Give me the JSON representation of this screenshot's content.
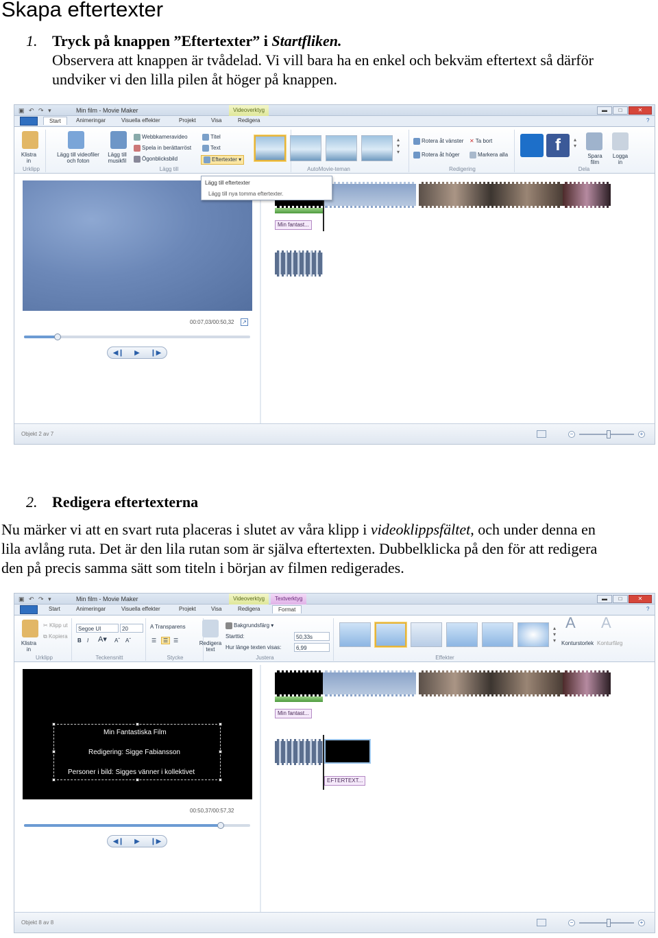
{
  "doc": {
    "title": "Skapa eftertexter",
    "step1": {
      "num": "1.",
      "heading_a": "Tryck på knappen ”Eftertexter” i ",
      "heading_b": "Startfliken.",
      "line2": "Observera att knappen är tvådelad. Vi vill bara ha en enkel och bekväm eftertext så därför",
      "line3": "undviker vi den lilla pilen åt höger på knappen."
    },
    "step2": {
      "num": "2.",
      "heading": "Redigera eftertexterna",
      "p1a": "Nu märker vi att en svart ruta placeras i slutet av våra klipp i ",
      "p1b": "videoklippsfältet",
      "p1c": ", och under denna en",
      "p2": "lila avlång ruta. Det är den lila rutan som är själva eftertexten. Dubbelklicka på den för att redigera",
      "p3": "den på precis samma sätt som titeln i början av filmen redigerades."
    }
  },
  "shot1": {
    "window_title": "Min film - Movie Maker",
    "context_tab": "Videoverktyg",
    "tabs": [
      "Start",
      "Animeringar",
      "Visuella effekter",
      "Projekt",
      "Visa",
      "Redigera"
    ],
    "ribbon": {
      "klistra": "Klistra in",
      "add_video": "Lägg till videofiler och foton",
      "add_music": "Lägg till musikfil",
      "webcam": "Webbkameravideo",
      "narration": "Spela in berättarröst",
      "snapshot": "Ögonblicksbild",
      "title": "Titel",
      "text": "Text",
      "credits": "Eftertexter",
      "rotate_left": "Rotera åt vänster",
      "rotate_right": "Rotera åt höger",
      "remove": "Ta bort",
      "select_all": "Markera alla",
      "save_movie": "Spara film",
      "login": "Logga in",
      "groups": [
        "Urklipp",
        "Lägg till",
        "AutoMovie-teman",
        "Redigering",
        "Dela"
      ]
    },
    "dropdown": {
      "heading": "Lägg till eftertexter",
      "item": "Lägg till nya tomma eftertexter."
    },
    "time": "00:07,03/00:50,32",
    "caption_tag": "Min fantast...",
    "status": "Objekt 2 av 7"
  },
  "shot2": {
    "window_title": "Min film - Movie Maker",
    "context_tabs": [
      "Videoverktyg",
      "Textverktyg"
    ],
    "tabs": [
      "Start",
      "Animeringar",
      "Visuella effekter",
      "Projekt",
      "Visa",
      "Redigera",
      "Format"
    ],
    "ribbon": {
      "klistra": "Klistra in",
      "klipp_ut": "Klipp ut",
      "kopiera": "Kopiera",
      "font": "Segoe UI",
      "size": "20",
      "transparens": "Transparens",
      "edit_text": "Redigera text",
      "bakgrund": "Bakgrundsfärg",
      "starttid_label": "Starttid:",
      "starttid": "50,33s",
      "hur_lange_label": "Hur länge texten visas:",
      "hur_lange": "6,99",
      "kontur_storlek": "Konturstorlek",
      "kontur_farg": "Konturfärg",
      "groups": [
        "Urklipp",
        "Teckensnitt",
        "Stycke",
        "Justera",
        "Effekter"
      ]
    },
    "overlay_lines": [
      "Min Fantastiska Film",
      "Redigering: Sigge Fabiansson",
      "Personer i bild: Sigges vänner i kollektivet"
    ],
    "time": "00:50,37/00:57,32",
    "caption_tag": "Min fantast...",
    "credits_tag": "EFTERTEXT...",
    "status": "Objekt 8 av 8"
  }
}
